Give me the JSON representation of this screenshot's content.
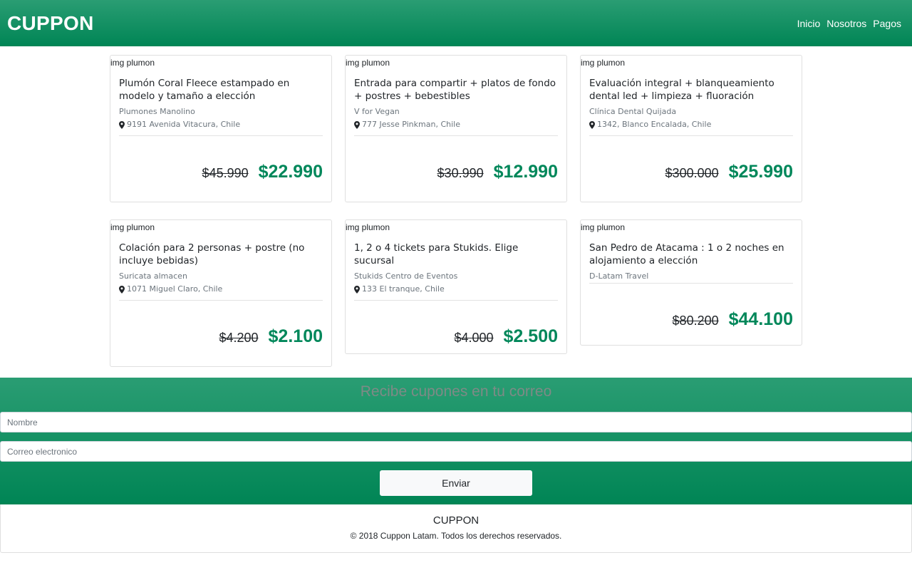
{
  "navbar": {
    "brand": "CUPPON",
    "links": [
      "Inicio",
      "Nosotros",
      "Pagos"
    ]
  },
  "deals": [
    {
      "img_alt": "img plumon",
      "title": "Plumón Coral Fleece estampado en modelo y tamaño a elección",
      "merchant": "Plumones Manolino",
      "address": "9191 Avenida Vitacura, Chile",
      "old_price": "$45.990",
      "new_price": "$22.990"
    },
    {
      "img_alt": "img plumon",
      "title": "Entrada para compartir + platos de fondo + postres + bebestibles",
      "merchant": "V for Vegan",
      "address": "777 Jesse Pinkman, Chile",
      "old_price": "$30.990",
      "new_price": "$12.990"
    },
    {
      "img_alt": "img plumon",
      "title": "Evaluación integral + blanqueamiento dental led + limpieza + fluoración",
      "merchant": "Clínica Dental Quijada",
      "address": "1342, Blanco Encalada, Chile",
      "old_price": "$300.000",
      "new_price": "$25.990"
    },
    {
      "img_alt": "img plumon",
      "title": "Colación para 2 personas + postre (no incluye bebidas)",
      "merchant": "Suricata almacen",
      "address": "1071 Miguel Claro, Chile",
      "old_price": "$4.200",
      "new_price": "$2.100"
    },
    {
      "img_alt": "img plumon",
      "title": "1, 2 o 4 tickets para Stukids. Elige sucursal",
      "merchant": "Stukids Centro de Eventos",
      "address": "133 El tranque, Chile",
      "old_price": "$4.000",
      "new_price": "$2.500"
    },
    {
      "img_alt": "img plumon",
      "title": "San Pedro de Atacama : 1 o 2 noches en alojamiento a elección",
      "merchant": "D-Latam Travel",
      "address": "",
      "old_price": "$80.200",
      "new_price": "$44.100"
    }
  ],
  "subscribe": {
    "title": "Recibe cupones en tu correo",
    "name_placeholder": "Nombre",
    "email_placeholder": "Correo electronico",
    "send_label": "Enviar"
  },
  "footer": {
    "brand": "CUPPON",
    "copyright": "© 2018 Cuppon Latam. Todos los derechos reservados."
  },
  "colors": {
    "brand_green": "#00875a",
    "header_gradient_top": "#2a9d73",
    "header_gradient_bottom": "#008555"
  },
  "icons": {
    "address": "map-pin-icon"
  }
}
